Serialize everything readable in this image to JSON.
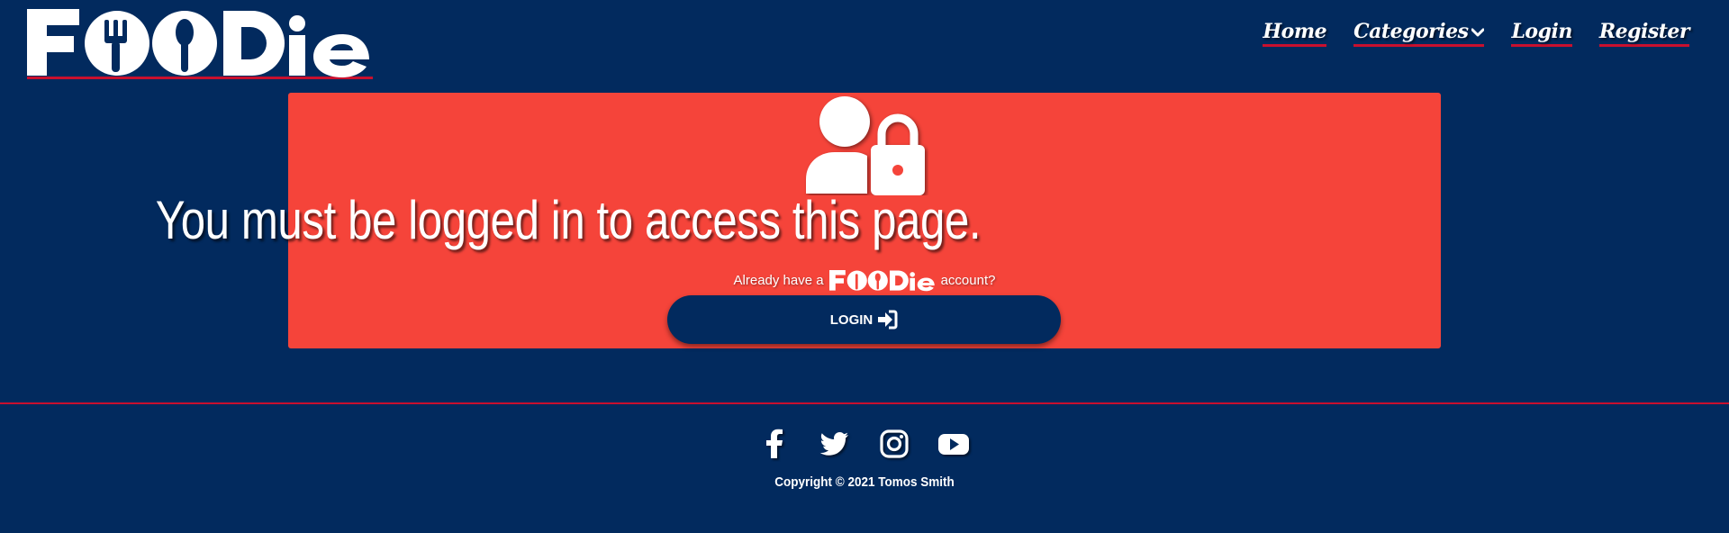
{
  "header": {
    "logo_text": "FOODie",
    "nav": [
      {
        "label": "Home"
      },
      {
        "label": "Categories"
      },
      {
        "label": "Login"
      },
      {
        "label": "Register"
      }
    ]
  },
  "alert": {
    "icon": "user-lock-icon",
    "title": "You must be logged in to access this page.",
    "already_prefix": "Already have a",
    "already_suffix": "account?",
    "login_button": "LOGIN",
    "login_icon": "sign-in-icon"
  },
  "footer": {
    "socials": [
      "facebook-icon",
      "twitter-icon",
      "instagram-icon",
      "youtube-icon"
    ],
    "copyright": "Copyright © 2021 Tomos Smith"
  },
  "colors": {
    "background": "#022a5e",
    "alert": "#f5443a",
    "accent": "#c8102e",
    "text": "#ffffff"
  }
}
